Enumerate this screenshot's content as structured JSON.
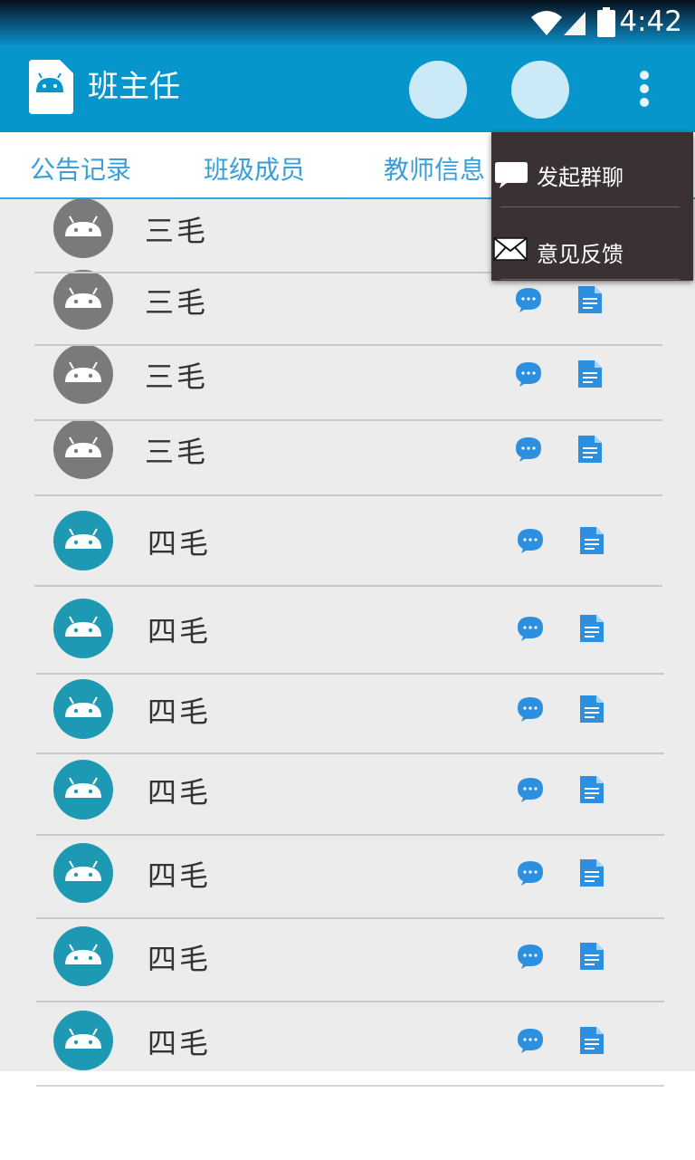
{
  "status_bar": {
    "time": "4:42"
  },
  "app_bar": {
    "title": "班主任"
  },
  "tabs": [
    {
      "label": "公告记录"
    },
    {
      "label": "班级成员"
    },
    {
      "label": "教师信息"
    }
  ],
  "members": [
    {
      "name": "三毛"
    },
    {
      "name": "三毛"
    },
    {
      "name": "三毛"
    },
    {
      "name": "三毛"
    },
    {
      "name": "四毛"
    },
    {
      "name": "四毛"
    },
    {
      "name": "四毛"
    },
    {
      "name": "四毛"
    },
    {
      "name": "四毛"
    },
    {
      "name": "四毛"
    },
    {
      "name": "四毛"
    }
  ],
  "overflow_menu": {
    "items": [
      {
        "label": "发起群聊",
        "icon": "chat-bubble-icon"
      },
      {
        "label": "意见反馈",
        "icon": "envelope-icon"
      }
    ]
  },
  "colors": {
    "app_bar": "#0796cc",
    "tab_text": "#3a9fd9",
    "avatar_gray": "#7a7a7a",
    "avatar_teal": "#1e99b3",
    "action_icons": "#2d8fe0",
    "menu_bg": "#3a3232"
  }
}
